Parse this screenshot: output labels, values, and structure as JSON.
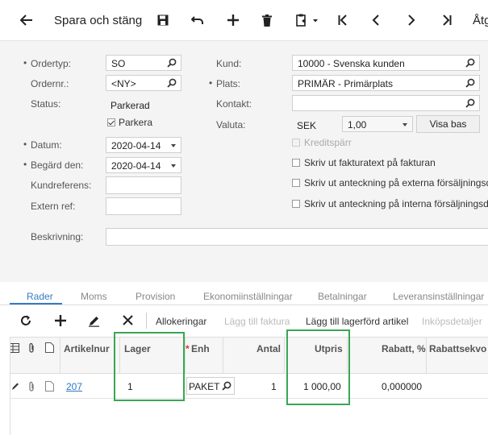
{
  "toolbar": {
    "back_icon": "arrow-left-icon",
    "save_close_label": "Spara och stäng",
    "icons": [
      "save-icon",
      "undo-icon",
      "add-icon",
      "delete-icon",
      "copy-paste-icon",
      "first-icon",
      "previous-icon",
      "next-icon",
      "last-icon"
    ],
    "more_label": "Åtg"
  },
  "form": {
    "ordertyp": {
      "label": "Ordertyp:",
      "value": "SO"
    },
    "ordernr": {
      "label": "Ordernr.:",
      "value": "<NY>"
    },
    "status": {
      "label": "Status:",
      "value": "Parkerad"
    },
    "parkera": {
      "label": "Parkera",
      "checked": true
    },
    "datum": {
      "label": "Datum:",
      "value": "2020-04-14"
    },
    "begard": {
      "label": "Begärd den:",
      "value": "2020-04-14"
    },
    "kundref": {
      "label": "Kundreferens:",
      "value": ""
    },
    "externref": {
      "label": "Extern ref:",
      "value": ""
    },
    "beskrivning": {
      "label": "Beskrivning:",
      "value": ""
    },
    "kund": {
      "label": "Kund:",
      "value": "10000 - Svenska kunden"
    },
    "plats": {
      "label": "Plats:",
      "value": "PRIMÄR - Primärplats"
    },
    "kontakt": {
      "label": "Kontakt:",
      "value": ""
    },
    "valuta": {
      "label": "Valuta:",
      "currency": "SEK",
      "rate": "1,00",
      "view_base_label": "Visa bas"
    },
    "kreditsparr": {
      "label": "Kreditspärr",
      "checked": false,
      "disabled": true
    },
    "fakturatext": {
      "label": "Skriv ut fakturatext på fakturan",
      "checked": false
    },
    "externa": {
      "label": "Skriv ut anteckning på externa försäljningsdok",
      "checked": false
    },
    "interna": {
      "label": "Skriv ut anteckning på interna försäljningsdoku",
      "checked": false
    }
  },
  "tabs": [
    "Rader",
    "Moms",
    "Provision",
    "Ekonomiinställningar",
    "Betalningar",
    "Leveransinställningar"
  ],
  "active_tab": "Rader",
  "grid_toolbar": {
    "icons": [
      "refresh-icon",
      "add-icon",
      "edit-icon",
      "close-icon"
    ],
    "allokeringar": "Allokeringar",
    "lagg_faktura": "Lägg till faktura",
    "lagg_lagerford": "Lägg till lagerförd artikel",
    "inkopsdetaljer": "Inköpsdetaljer"
  },
  "grid": {
    "columns": [
      "Artikelnur",
      "Lager",
      "Enh",
      "Antal",
      "Utpris",
      "Rabatt, %",
      "Rabattsekvo"
    ],
    "required_mark": "*",
    "rows": [
      {
        "artikel": "207",
        "lager": "1",
        "enh": "PAKET",
        "antal": "1",
        "utpris": "1 000,00",
        "rabatt": "0,000000",
        "rabattsekv": ""
      }
    ]
  },
  "colors": {
    "accent": "#3a7bbf",
    "highlight": "#3aa655",
    "form_bg": "#f4f4f4"
  }
}
